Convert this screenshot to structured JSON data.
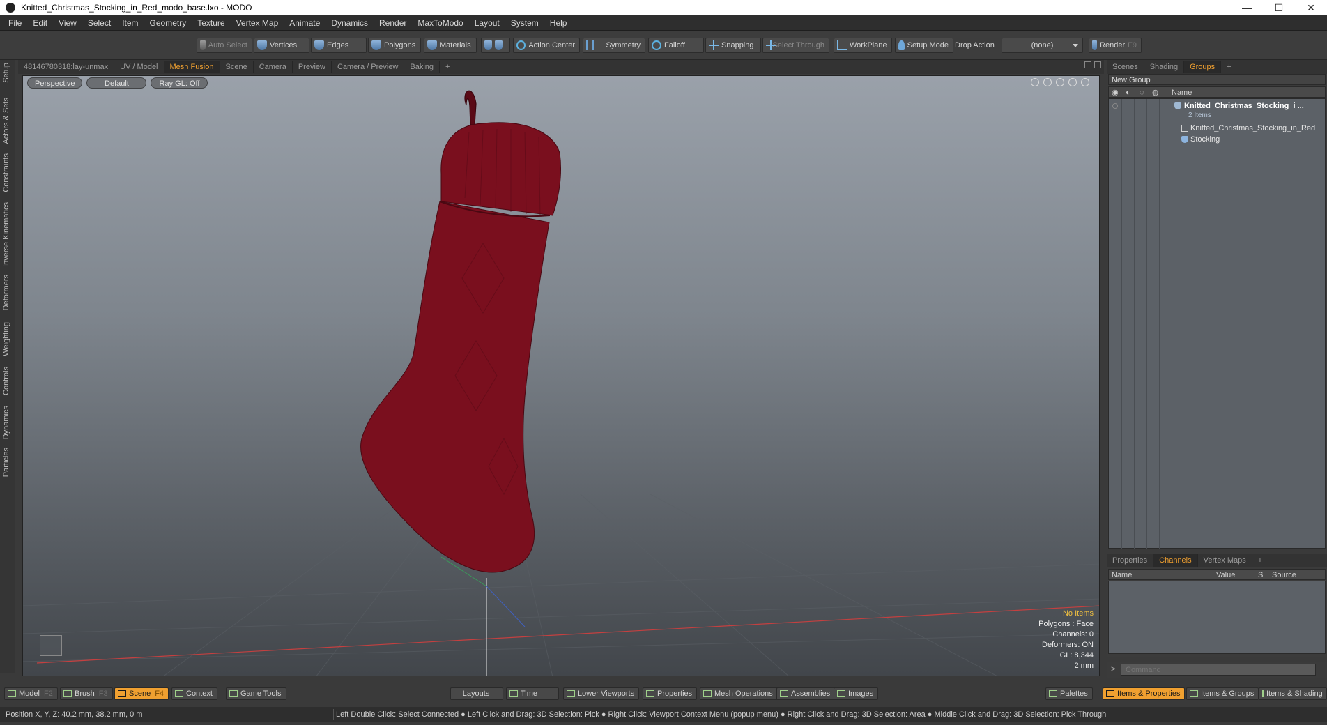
{
  "window": {
    "title": "Knitted_Christmas_Stocking_in_Red_modo_base.lxo - MODO",
    "controls": [
      "—",
      "☐",
      "✕"
    ]
  },
  "menubar": [
    "File",
    "Edit",
    "View",
    "Select",
    "Item",
    "Geometry",
    "Texture",
    "Vertex Map",
    "Animate",
    "Dynamics",
    "Render",
    "MaxToModo",
    "Layout",
    "System",
    "Help"
  ],
  "toolbar": {
    "auto_select": "Auto Select",
    "vertices": "Vertices",
    "edges": "Edges",
    "polygons": "Polygons",
    "materials": "Materials",
    "action_center": "Action Center",
    "symmetry": "Symmetry",
    "falloff": "Falloff",
    "snapping": "Snapping",
    "select_through": "Select Through",
    "workplane": "WorkPlane",
    "setup_mode": "Setup Mode",
    "drop_action_label": "Drop Action",
    "drop_action_value": "(none)",
    "render": "Render",
    "render_key": "F9"
  },
  "left_tabs": [
    "Setup",
    "Actors & Sets",
    "Constraints",
    "Inverse Kinematics",
    "Deformers",
    "Weighting",
    "Controls",
    "Dynamics",
    "Particles"
  ],
  "viewport_tabs": [
    "48146780318:lay-unmax",
    "UV / Model",
    "Mesh Fusion",
    "Scene",
    "Camera",
    "Preview",
    "Camera / Preview",
    "Baking",
    "+"
  ],
  "viewport_active_tab": "Mesh Fusion",
  "viewport": {
    "view_mode": "Perspective",
    "shading": "Default",
    "raygl": "Ray GL: Off",
    "stats": {
      "items": "No Items",
      "polygons": "Polygons : Face",
      "channels": "Channels: 0",
      "deformers": "Deformers: ON",
      "gl": "GL: 8,344",
      "scale": "2 mm"
    },
    "stocking_color": "#7a0f1e"
  },
  "right_tabs": [
    "Scenes",
    "Shading",
    "Groups",
    "+"
  ],
  "right_active_tab": "Groups",
  "groups": {
    "new_group": "New Group",
    "name_header": "Name",
    "tree": {
      "root": "Knitted_Christmas_Stocking_i ...",
      "root_sub": "2 Items",
      "child1": "Knitted_Christmas_Stocking_in_Red",
      "child2": "Stocking"
    }
  },
  "channel_tabs": [
    "Properties",
    "Channels",
    "Vertex Maps",
    "+"
  ],
  "channel_active_tab": "Channels",
  "channels": {
    "headers": [
      "Name",
      "Value",
      "S",
      "Source"
    ]
  },
  "command": {
    "placeholder": "Command"
  },
  "bottombar": {
    "model": "Model",
    "model_key": "F2",
    "brush": "Brush",
    "brush_key": "F3",
    "scene": "Scene",
    "scene_key": "F4",
    "context": "Context",
    "game_tools": "Game Tools",
    "layouts": "Layouts",
    "time": "Time",
    "lower_viewports": "Lower Viewports",
    "properties": "Properties",
    "mesh_operations": "Mesh Operations",
    "assemblies": "Assemblies",
    "images": "Images",
    "palettes": "Palettes",
    "items_properties": "Items & Properties",
    "items_groups": "Items & Groups",
    "items_shading": "Items & Shading"
  },
  "statusbar": {
    "position": "Position X, Y, Z:   40.2 mm, 38.2 mm, 0 m",
    "hint": "Left Double Click: Select Connected ● Left Click and Drag: 3D Selection: Pick ● Right Click: Viewport Context Menu (popup menu) ● Right Click and Drag: 3D Selection: Area ● Middle Click and Drag: 3D Selection: Pick Through"
  }
}
